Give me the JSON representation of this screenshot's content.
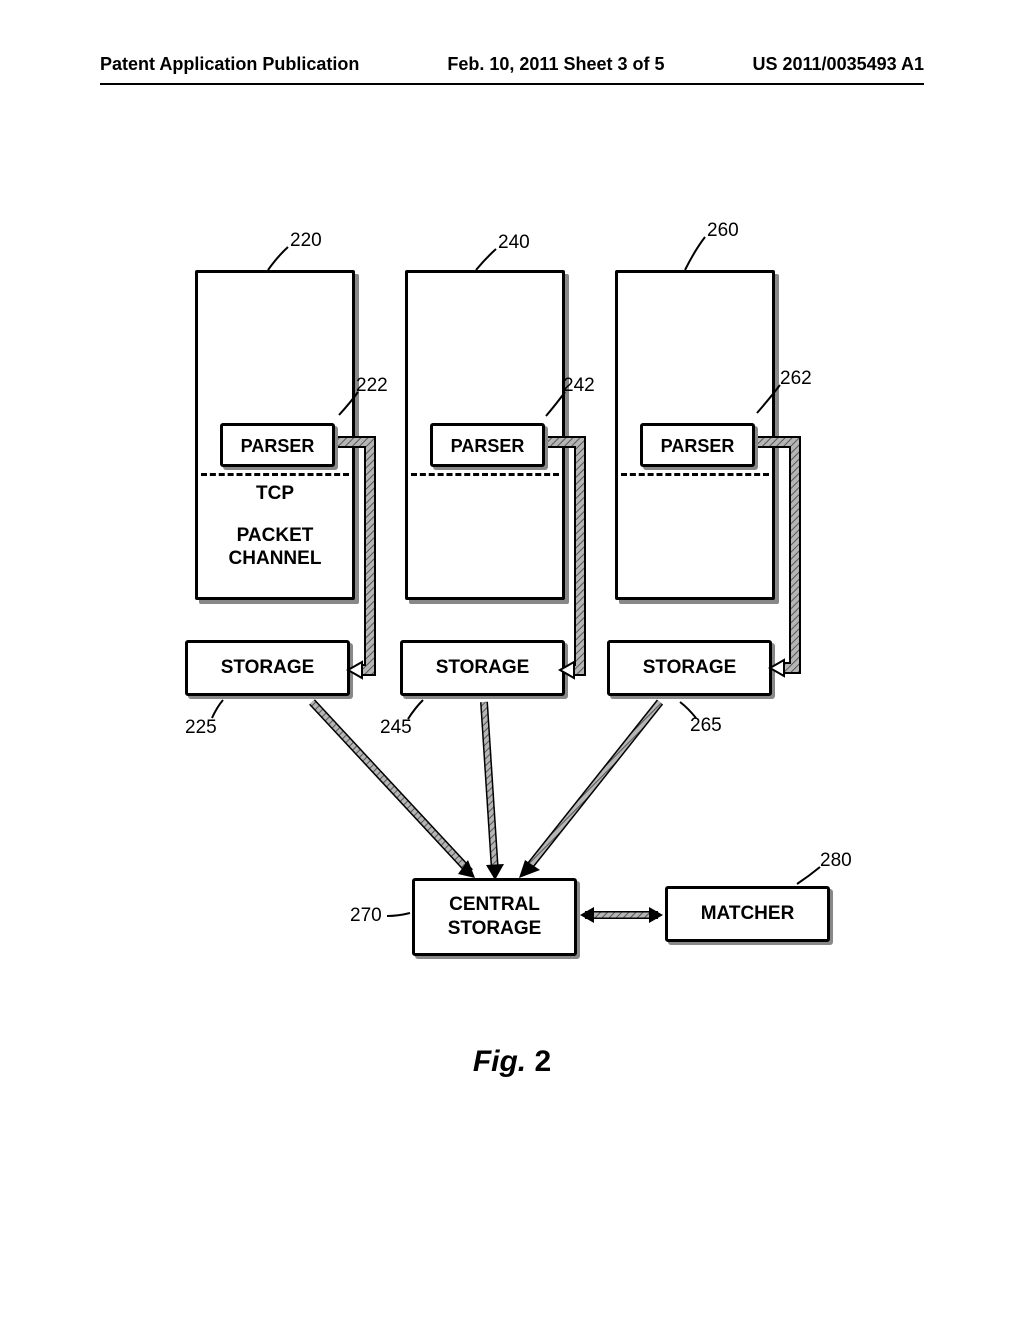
{
  "header": {
    "left": "Patent Application Publication",
    "center": "Feb. 10, 2011  Sheet 3 of 5",
    "right": "US 2011/0035493 A1"
  },
  "labels": {
    "parser": "PARSER",
    "tcp": "TCP",
    "packet_channel_line1": "PACKET",
    "packet_channel_line2": "CHANNEL",
    "storage": "STORAGE",
    "central_storage_line1": "CENTRAL",
    "central_storage_line2": "STORAGE",
    "matcher": "MATCHER"
  },
  "refs": {
    "r220": "220",
    "r222": "222",
    "r240": "240",
    "r242": "242",
    "r260": "260",
    "r262": "262",
    "r225": "225",
    "r245": "245",
    "r265": "265",
    "r270": "270",
    "r280": "280"
  },
  "figure": {
    "prefix": "Fig.",
    "number": "2"
  }
}
